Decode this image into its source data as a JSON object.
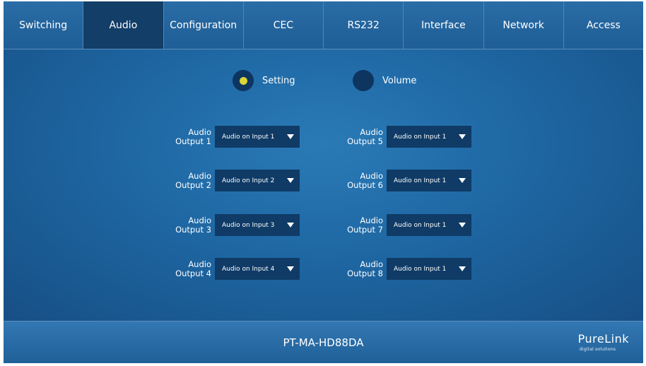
{
  "nav": {
    "tabs": [
      {
        "label": "Switching",
        "active": false
      },
      {
        "label": "Audio",
        "active": true
      },
      {
        "label": "Configuration",
        "active": false
      },
      {
        "label": "CEC",
        "active": false
      },
      {
        "label": "RS232",
        "active": false
      },
      {
        "label": "Interface",
        "active": false
      },
      {
        "label": "Network",
        "active": false
      },
      {
        "label": "Access",
        "active": false
      }
    ]
  },
  "modes": {
    "setting": {
      "label": "Setting",
      "selected": true
    },
    "volume": {
      "label": "Volume",
      "selected": false
    }
  },
  "outputs": [
    {
      "line1": "Audio",
      "line2": "Output 1",
      "value": "Audio on Input 1"
    },
    {
      "line1": "Audio",
      "line2": "Output 2",
      "value": "Audio on Input 2"
    },
    {
      "line1": "Audio",
      "line2": "Output 3",
      "value": "Audio on Input 3"
    },
    {
      "line1": "Audio",
      "line2": "Output 4",
      "value": "Audio on Input 4"
    },
    {
      "line1": "Audio",
      "line2": "Output 5",
      "value": "Audio on Input 1"
    },
    {
      "line1": "Audio",
      "line2": "Output 6",
      "value": "Audio on Input 1"
    },
    {
      "line1": "Audio",
      "line2": "Output 7",
      "value": "Audio on Input 1"
    },
    {
      "line1": "Audio",
      "line2": "Output 8",
      "value": "Audio on Input 1"
    }
  ],
  "footer": {
    "model": "PT-MA-HD88DA",
    "brand_name": "PureLink",
    "brand_tagline": "digital solutions"
  },
  "colors": {
    "background": "#1a5386",
    "active_tab": "#123e67",
    "select_bg": "#0f3b66",
    "radio_selected": "#d9d63a"
  }
}
